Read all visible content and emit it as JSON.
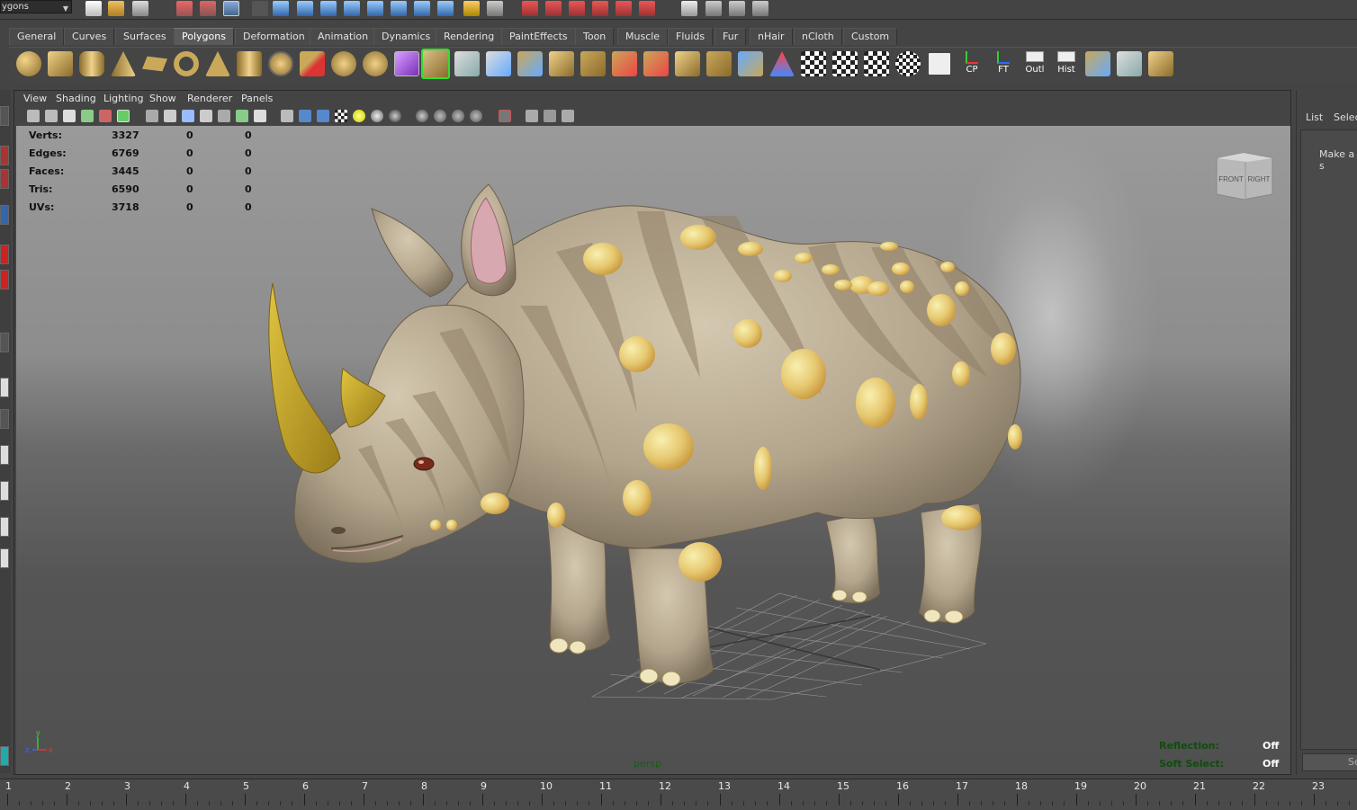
{
  "statusline": {
    "menu_set": "ygons"
  },
  "shelf_tabs": [
    "General",
    "Curves",
    "Surfaces",
    "Polygons",
    "Deformation",
    "Animation",
    "Dynamics",
    "Rendering",
    "PaintEffects",
    "Toon",
    "Muscle",
    "Fluids",
    "Fur",
    "nHair",
    "nCloth",
    "Custom"
  ],
  "active_shelf_tab": "Polygons",
  "shelf_labels": {
    "cp": "CP",
    "ft": "FT",
    "outl": "Outl",
    "hist": "Hist"
  },
  "panel_menu": [
    "View",
    "Shading",
    "Lighting",
    "Show",
    "Renderer",
    "Panels"
  ],
  "hud": {
    "rows": [
      {
        "label": "Verts:",
        "v1": "3327",
        "v2": "0",
        "v3": "0"
      },
      {
        "label": "Edges:",
        "v1": "6769",
        "v2": "0",
        "v3": "0"
      },
      {
        "label": "Faces:",
        "v1": "3445",
        "v2": "0",
        "v3": "0"
      },
      {
        "label": "Tris:",
        "v1": "6590",
        "v2": "0",
        "v3": "0"
      },
      {
        "label": "UVs:",
        "v1": "3718",
        "v2": "0",
        "v3": "0"
      }
    ],
    "reflection_label": "Reflection:",
    "reflection_value": "Off",
    "soft_select_label": "Soft Select:",
    "soft_select_value": "Off"
  },
  "viewcube": {
    "front": "FRONT",
    "right": "RIGHT"
  },
  "camera": "persp",
  "axis": {
    "y": "y",
    "z": "z",
    "x": "x"
  },
  "sidebar": {
    "list": "List",
    "select": "Selec",
    "message": "Make a s",
    "button": "Se"
  },
  "timeline": {
    "frames": [
      "1",
      "2",
      "3",
      "4",
      "5",
      "6",
      "7",
      "8",
      "9",
      "10",
      "11",
      "12",
      "13",
      "14",
      "15",
      "16",
      "17",
      "18",
      "19",
      "20",
      "21",
      "22",
      "23"
    ]
  },
  "colors": {
    "hud_green": "#0d4d0d",
    "accent_tab": "#5a5a5a",
    "rhino_skin": "#b5a78f",
    "horn": "#c8a72a",
    "spots": "#e8d27a"
  }
}
